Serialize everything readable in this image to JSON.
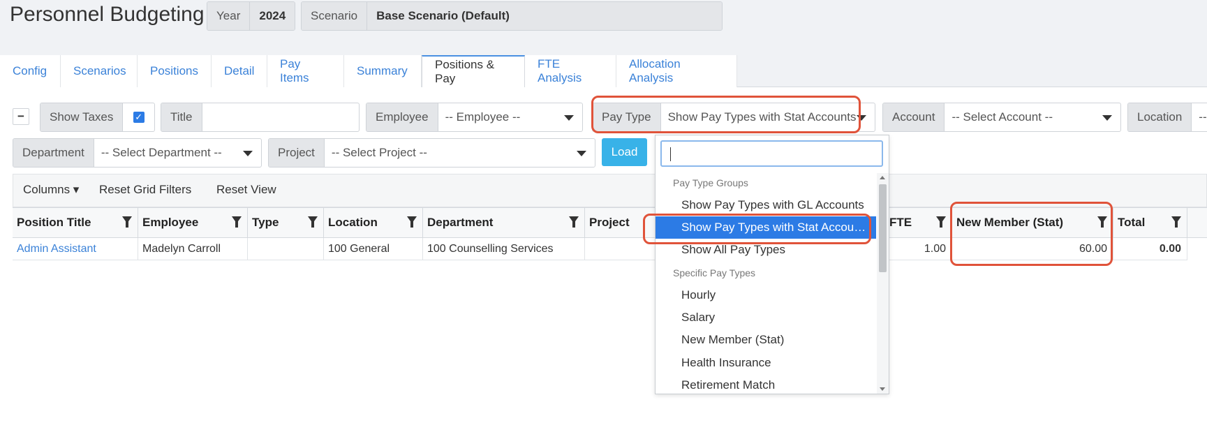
{
  "page": {
    "title": "Personnel Budgeting"
  },
  "header": {
    "year_label": "Year",
    "year_value": "2024",
    "scenario_label": "Scenario",
    "scenario_value": "Base Scenario (Default)"
  },
  "tabs": [
    {
      "label": "Config"
    },
    {
      "label": "Scenarios"
    },
    {
      "label": "Positions"
    },
    {
      "label": "Detail"
    },
    {
      "label": "Pay Items"
    },
    {
      "label": "Summary"
    },
    {
      "label": "Positions & Pay"
    },
    {
      "label": "FTE Analysis"
    },
    {
      "label": "Allocation Analysis"
    }
  ],
  "active_tab": "Positions & Pay",
  "filters": {
    "collapse_symbol": "−",
    "show_taxes_label": "Show Taxes",
    "show_taxes_checked": "✓",
    "title_label": "Title",
    "title_value": "",
    "employee_label": "Employee",
    "employee_value": "-- Employee --",
    "pay_type_label": "Pay Type",
    "pay_type_value": "Show Pay Types with Stat Accounts",
    "account_label": "Account",
    "account_value": "-- Select Account --",
    "location_label": "Location",
    "location_value": "--",
    "department_label": "Department",
    "department_value": "-- Select Department --",
    "project_label": "Project",
    "project_value": "-- Select Project --",
    "load_label": "Load"
  },
  "grid_toolbar": {
    "columns": "Columns ▾",
    "reset_filters": "Reset Grid Filters",
    "reset_view": "Reset View"
  },
  "grid": {
    "columns": [
      "Position Title",
      "Employee",
      "Type",
      "Location",
      "Department",
      "Project",
      "FTE",
      "New Member (Stat)",
      "Total"
    ],
    "rows": [
      [
        "Admin Assistant",
        "Madelyn Carroll",
        "",
        "100 General",
        "100 Counselling Services",
        "",
        "1.00",
        "60.00",
        "0.00"
      ]
    ]
  },
  "pay_type_dropdown": {
    "search_value": "",
    "groups": [
      {
        "label": "Pay Type Groups",
        "options": [
          "Show Pay Types with GL Accounts",
          "Show Pay Types with Stat Accou…",
          "Show All Pay Types"
        ]
      },
      {
        "label": "Specific Pay Types",
        "options": [
          "Hourly",
          "Salary",
          "New Member (Stat)",
          "Health Insurance",
          "Retirement Match"
        ]
      }
    ],
    "highlighted": "Show Pay Types with Stat Accounts"
  },
  "colors": {
    "accent": "#2c7be5",
    "link": "#3b82d8",
    "load_button": "#38b2e8",
    "annotation": "#e0533a"
  }
}
